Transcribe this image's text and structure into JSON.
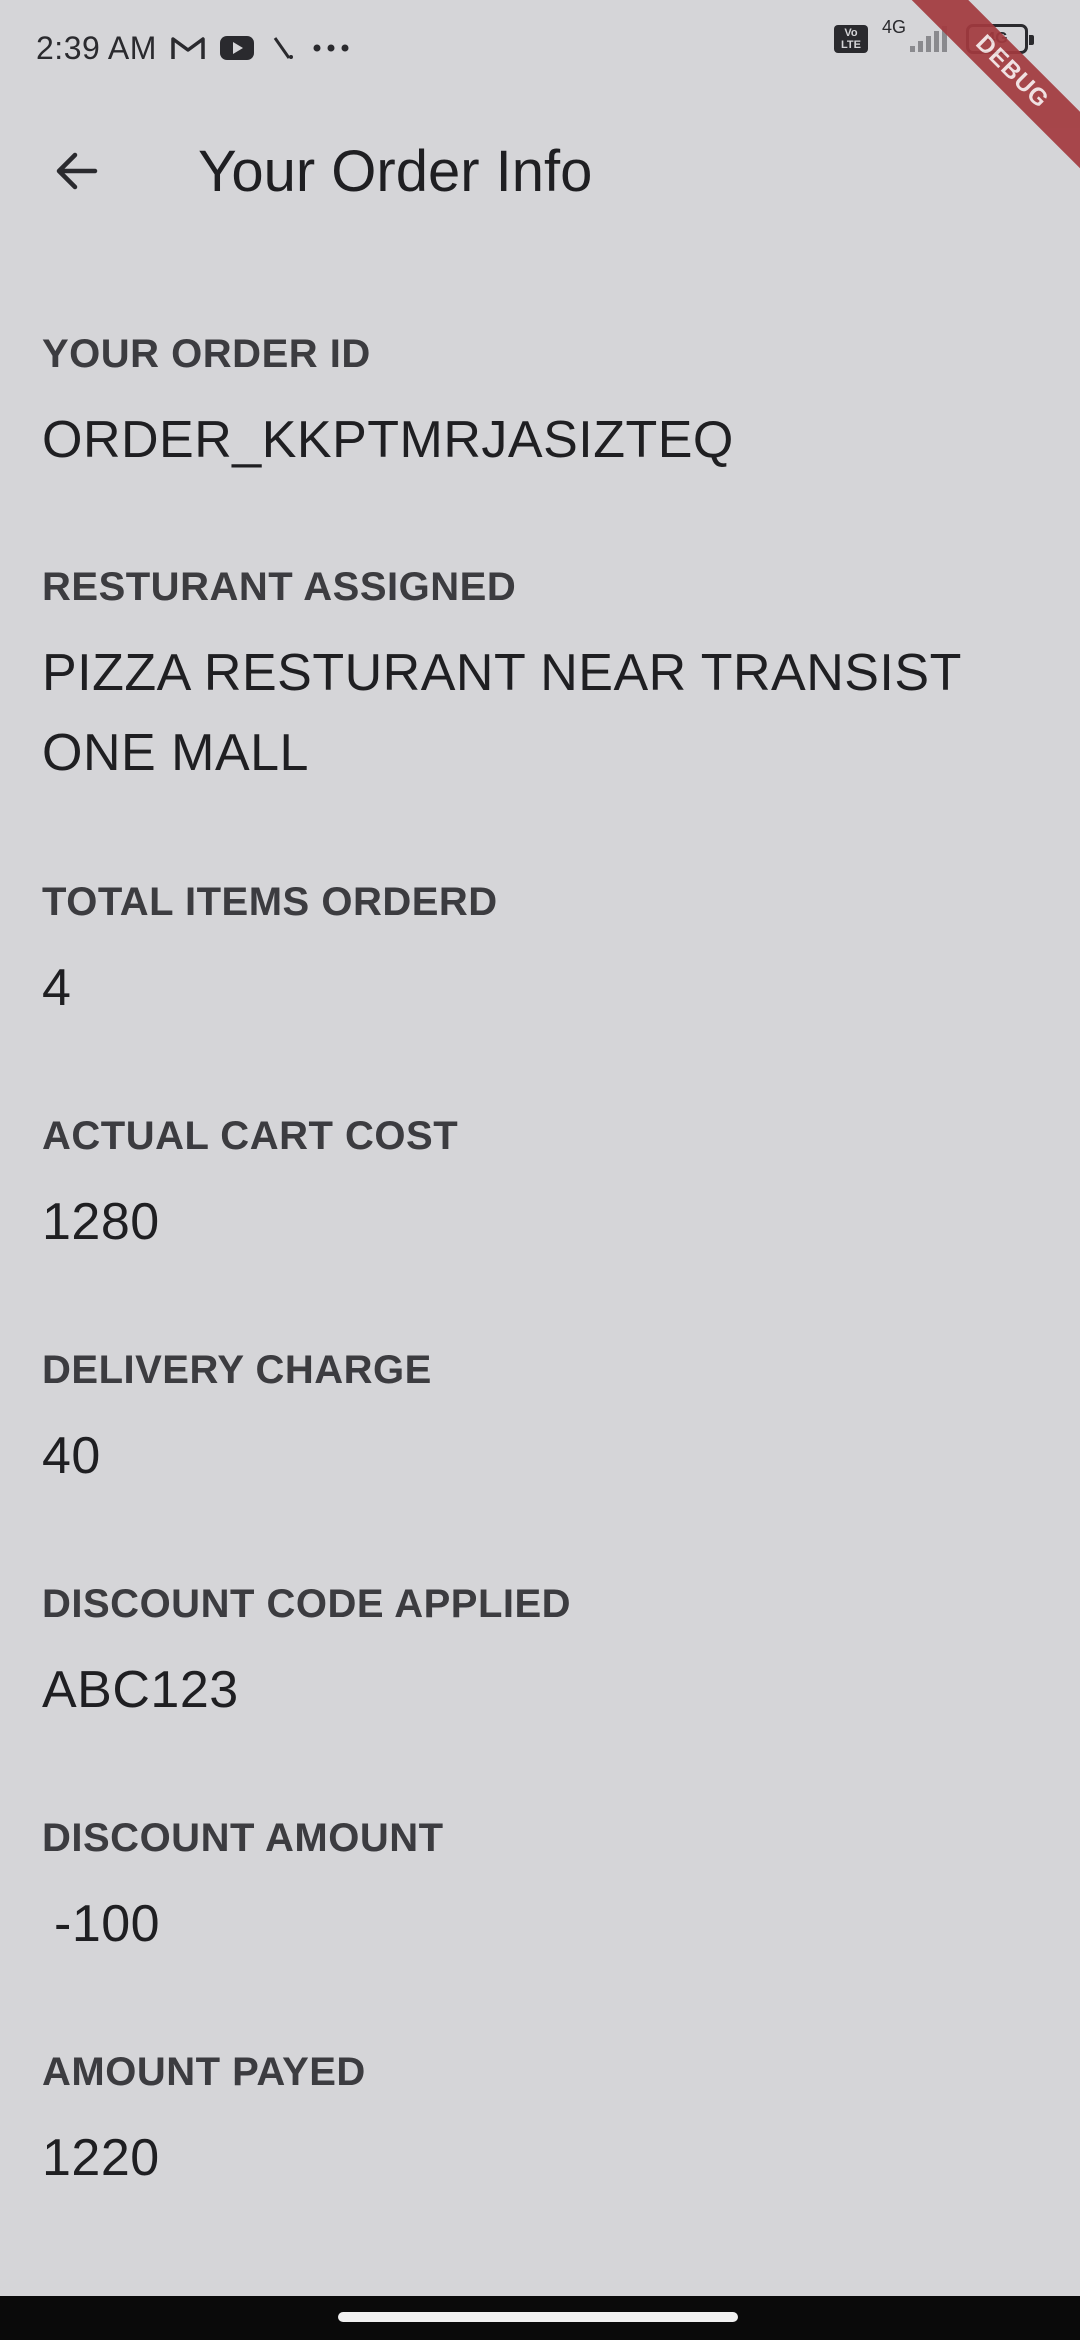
{
  "status_bar": {
    "time": "2:39 AM",
    "icons_left": [
      "gmail-icon",
      "youtube-icon",
      "signal-slash-icon",
      "more-dots-icon"
    ],
    "volte_label": "Vo LTE",
    "network_label_1": "4G",
    "battery_label": "4G"
  },
  "debug_banner": "DEBUG",
  "app_bar": {
    "back_icon": "arrow-left-icon",
    "title": "Your Order Info"
  },
  "order": {
    "order_id": {
      "label": "YOUR ORDER ID",
      "value": "ORDER_KKPTMRJASIZTEQ"
    },
    "restaurant": {
      "label": "RESTURANT ASSIGNED",
      "value": "PIZZA RESTURANT NEAR TRANSIST ONE MALL"
    },
    "total_items": {
      "label": "TOTAL ITEMS ORDERD",
      "value": "4"
    },
    "cart_cost": {
      "label": "ACTUAL CART COST",
      "value": "1280"
    },
    "delivery_charge": {
      "label": "DELIVERY CHARGE",
      "value": "40"
    },
    "discount_code": {
      "label": "DISCOUNT CODE APPLIED",
      "value": "ABC123"
    },
    "discount_amount": {
      "label": "DISCOUNT AMOUNT",
      "value": "-100"
    },
    "amount_payed": {
      "label": "AMOUNT PAYED",
      "value": "1220"
    }
  },
  "colors": {
    "background": "#d5d5d8",
    "text_primary": "#1f1f22",
    "text_label": "#3c3c40",
    "debug_ribbon": "#a33a3f",
    "nav_bar": "#0a0a0a"
  }
}
